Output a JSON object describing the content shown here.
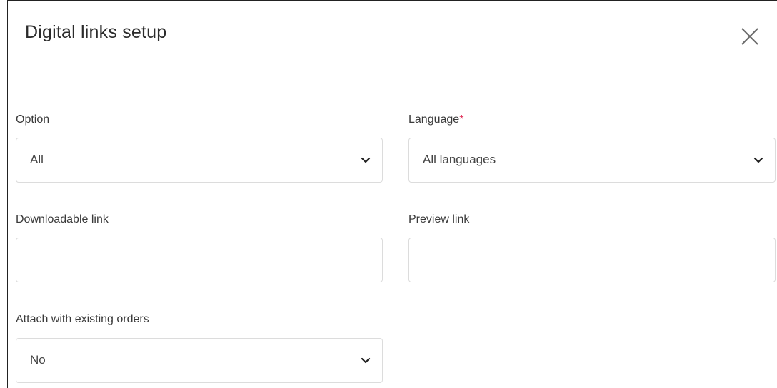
{
  "header": {
    "title": "Digital links setup",
    "close_icon": "close-icon"
  },
  "form": {
    "option": {
      "label": "Option",
      "value": "All"
    },
    "language": {
      "label": "Language",
      "required_mark": "*",
      "value": "All languages"
    },
    "downloadable_link": {
      "label": "Downloadable link",
      "value": ""
    },
    "preview_link": {
      "label": "Preview link",
      "value": ""
    },
    "attach_existing_orders": {
      "label": "Attach with existing orders",
      "value": "No"
    }
  },
  "colors": {
    "required": "#e0325a",
    "border": "#dcdcdc",
    "divider": "#e3e3e3"
  }
}
